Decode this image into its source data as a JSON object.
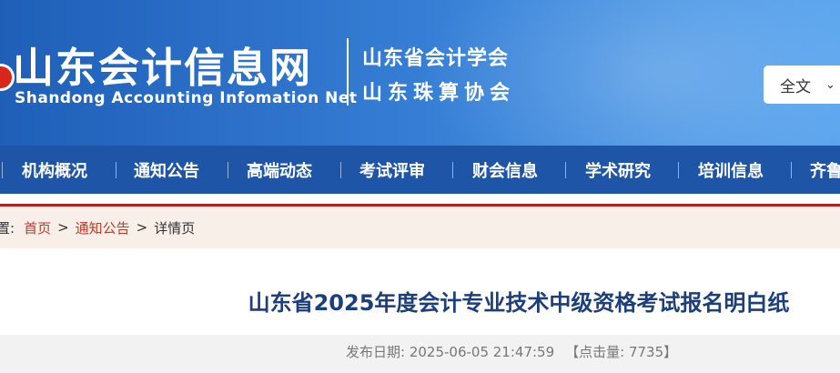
{
  "header": {
    "site_title": "山东会计信息网",
    "site_title_en": "Shandong Accounting Infomation Net",
    "org_1": "山东省会计学会",
    "org_2": "山东珠算协会",
    "search_scope_selected": "全文"
  },
  "nav": {
    "items": [
      {
        "label": "机构概况"
      },
      {
        "label": "通知公告"
      },
      {
        "label": "高端动态"
      },
      {
        "label": "考试评审"
      },
      {
        "label": "财会信息"
      },
      {
        "label": "学术研究"
      },
      {
        "label": "培训信息"
      },
      {
        "label": "齐鲁"
      }
    ]
  },
  "breadcrumb": {
    "prefix": "置:",
    "items": [
      {
        "label": "首页"
      },
      {
        "label": "通知公告"
      },
      {
        "label": "详情页"
      }
    ],
    "separator": ">"
  },
  "article": {
    "title": "山东省2025年度会计专业技术中级资格考试报名明白纸",
    "publish_date": "发布日期: 2025-06-05 21:47:59",
    "click_count": "【点击量: 7735】"
  },
  "colors": {
    "header_blue": "#2f74cc",
    "nav_blue": "#1f55a6",
    "red_rule": "#b41f1f",
    "link_red": "#c0392b",
    "title_navy": "#1c3e7a"
  }
}
